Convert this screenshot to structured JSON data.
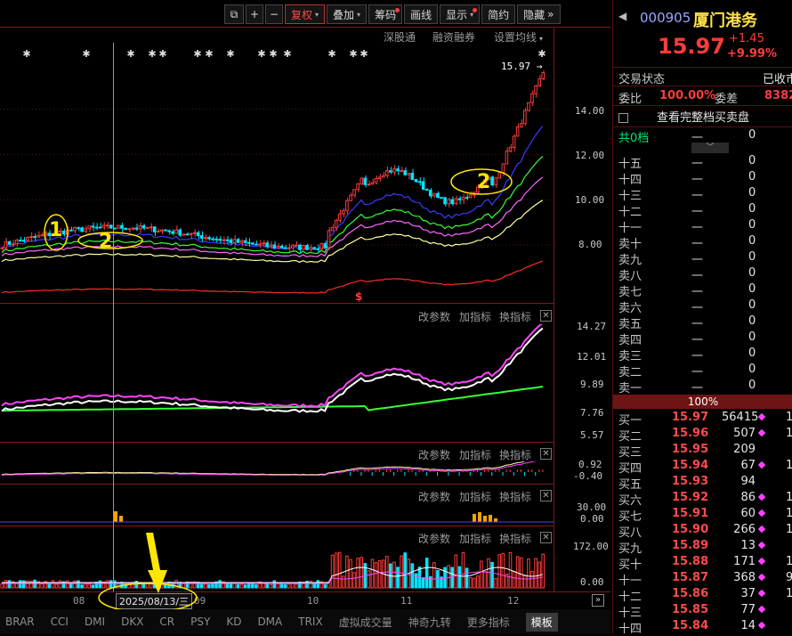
{
  "toolbar": {
    "buttons": [
      "复权",
      "叠加",
      "筹码",
      "画线",
      "显示",
      "简约",
      "隐藏"
    ],
    "expand": "»"
  },
  "subbar": {
    "items": [
      "深股通",
      "融资融券",
      "设置均线"
    ]
  },
  "main_chart": {
    "price_labels": [
      "14.00",
      "12.00",
      "10.00",
      "8.00"
    ],
    "last_price_marker": "15.97",
    "annotations": [
      "1",
      "2",
      "2"
    ],
    "marker_s": "$"
  },
  "indicator_headers": {
    "change_params": "改参数",
    "add_indicator": "加指标",
    "switch_indicator": "换指标",
    "close": "✕"
  },
  "indicator1_axis": [
    "14.27",
    "12.01",
    "9.89",
    "7.76",
    "5.57"
  ],
  "indicator2_axis": [
    "0.92",
    "-0.40"
  ],
  "indicator3_axis": [
    "30.00",
    "0.00"
  ],
  "indicator4_axis": [
    "172.00",
    "0.00"
  ],
  "x_axis": [
    "08",
    "09",
    "10",
    "11",
    "12"
  ],
  "cursor_date": "2025/08/13/三",
  "bottom_tabs": [
    "BRAR",
    "CCI",
    "DMI",
    "DKX",
    "CR",
    "PSY",
    "KD",
    "DMA",
    "TRIX",
    "虚拟成交量",
    "神奇九转",
    "更多指标",
    "模板"
  ],
  "quote": {
    "code": "000905",
    "name": "厦门港务",
    "price": "15.97",
    "change": "+1.45",
    "change_pct": "+9.99%",
    "trade_status_label": "交易状态",
    "trade_status": "已收市",
    "ratio_label": "委比",
    "ratio_value": "100.00%",
    "diff_label": "委差",
    "diff_value": "8382",
    "full_book": "查看完整档买卖盘",
    "levels_label": "共0档",
    "levels_dash": "一",
    "levels_value": "0",
    "book_pct": "100%"
  },
  "sell_levels": [
    {
      "label": "十五",
      "price": "一",
      "vol": "0"
    },
    {
      "label": "十四",
      "price": "一",
      "vol": "0"
    },
    {
      "label": "十三",
      "price": "一",
      "vol": "0"
    },
    {
      "label": "十二",
      "price": "一",
      "vol": "0"
    },
    {
      "label": "十一",
      "price": "一",
      "vol": "0"
    },
    {
      "label": "卖十",
      "price": "一",
      "vol": "0"
    },
    {
      "label": "卖九",
      "price": "一",
      "vol": "0"
    },
    {
      "label": "卖八",
      "price": "一",
      "vol": "0"
    },
    {
      "label": "卖七",
      "price": "一",
      "vol": "0"
    },
    {
      "label": "卖六",
      "price": "一",
      "vol": "0"
    },
    {
      "label": "卖五",
      "price": "一",
      "vol": "0"
    },
    {
      "label": "卖四",
      "price": "一",
      "vol": "0"
    },
    {
      "label": "卖三",
      "price": "一",
      "vol": "0"
    },
    {
      "label": "卖二",
      "price": "一",
      "vol": "0"
    },
    {
      "label": "卖一",
      "price": "一",
      "vol": "0"
    }
  ],
  "buy_levels": [
    {
      "label": "买一",
      "price": "15.97",
      "vol": "56415",
      "dot": true,
      "tail": "1"
    },
    {
      "label": "买二",
      "price": "15.96",
      "vol": "507",
      "dot": true,
      "tail": "1"
    },
    {
      "label": "买三",
      "price": "15.95",
      "vol": "209",
      "dot": false,
      "tail": ""
    },
    {
      "label": "买四",
      "price": "15.94",
      "vol": "67",
      "dot": true,
      "tail": "1"
    },
    {
      "label": "买五",
      "price": "15.93",
      "vol": "94",
      "dot": false,
      "tail": ""
    },
    {
      "label": "买六",
      "price": "15.92",
      "vol": "86",
      "dot": true,
      "tail": "1"
    },
    {
      "label": "买七",
      "price": "15.91",
      "vol": "60",
      "dot": true,
      "tail": "1"
    },
    {
      "label": "买八",
      "price": "15.90",
      "vol": "266",
      "dot": true,
      "tail": "1"
    },
    {
      "label": "买九",
      "price": "15.89",
      "vol": "13",
      "dot": true,
      "tail": ""
    },
    {
      "label": "买十",
      "price": "15.88",
      "vol": "171",
      "dot": true,
      "tail": "1"
    },
    {
      "label": "十一",
      "price": "15.87",
      "vol": "368",
      "dot": true,
      "tail": "9"
    },
    {
      "label": "十二",
      "price": "15.86",
      "vol": "37",
      "dot": true,
      "tail": "1"
    },
    {
      "label": "十三",
      "price": "15.85",
      "vol": "77",
      "dot": true,
      "tail": ""
    },
    {
      "label": "十四",
      "price": "15.84",
      "vol": "14",
      "dot": true,
      "tail": ""
    }
  ],
  "colors": {
    "up": "#ff3c3c",
    "down": "#00e5ff",
    "bg": "#000000",
    "magenta": "#ff44ff",
    "yellow_annot": "#ffe600"
  }
}
